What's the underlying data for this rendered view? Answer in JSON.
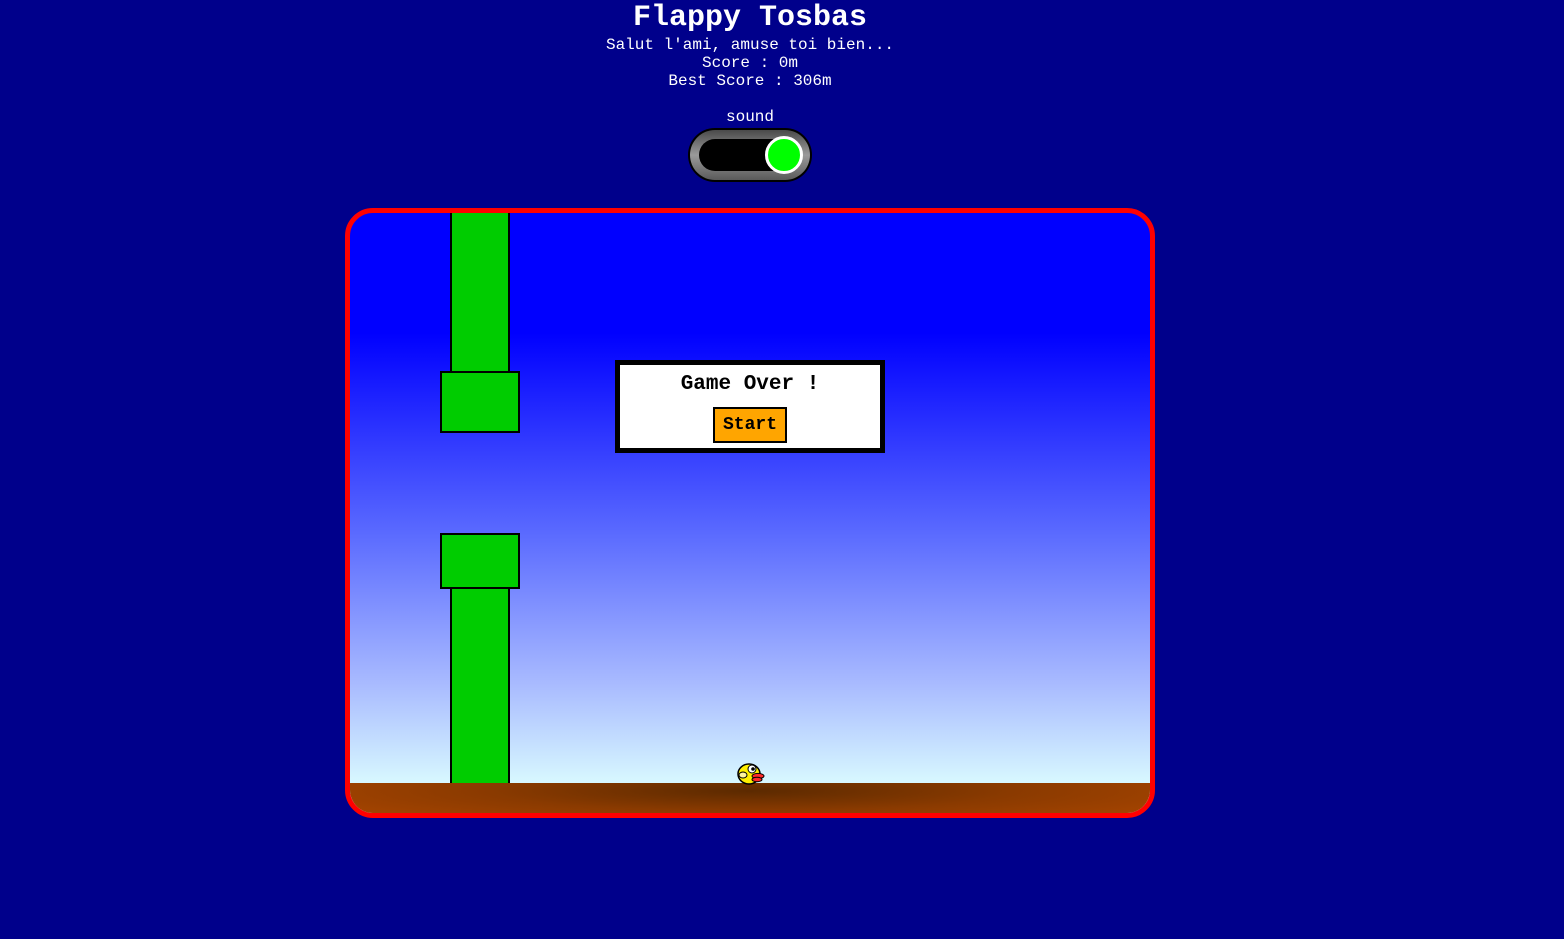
{
  "header": {
    "title": "Flappy Tosbas",
    "subtitle": "Salut l'ami, amuse toi bien...",
    "score_text": "Score : 0m",
    "best_score_text": "Best Score : 306m"
  },
  "sound": {
    "label": "sound",
    "enabled": true,
    "knob_color": "#00ff00"
  },
  "game": {
    "state": "game-over",
    "dialog_title": "Game Over !",
    "start_label": "Start",
    "colors": {
      "page_background": "#00008b",
      "frame_border": "#ff0000",
      "pipe": "#00cc00",
      "bird": "#ffee00",
      "start_button": "#ffa500",
      "ground": "#a84500"
    },
    "icons": [
      "bird-icon",
      "pipe-top",
      "pipe-bottom"
    ]
  }
}
